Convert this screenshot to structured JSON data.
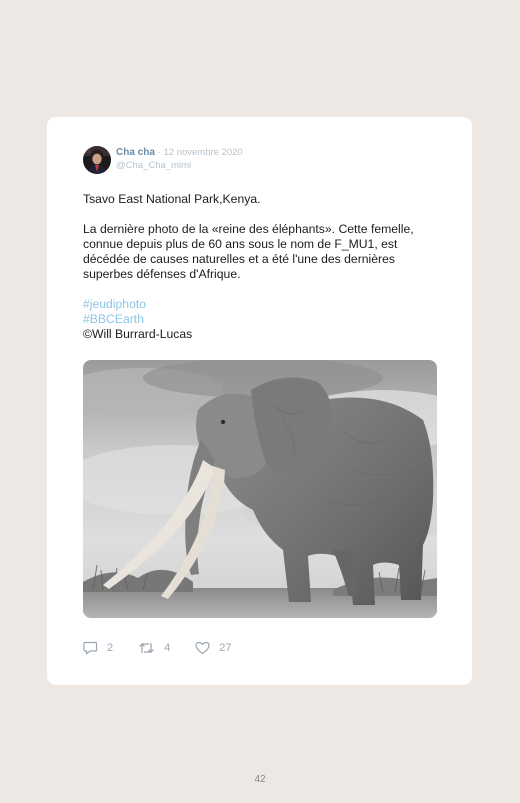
{
  "tweet": {
    "author_name": "Cha cha",
    "date": "· 12 novembre 2020",
    "handle": "@Cha_Cha_mimi",
    "location_line": "Tsavo East National Park,Kenya.",
    "body_text": "La dernière photo de la «reine des éléphants». Cette femelle, connue depuis plus de 60 ans sous le nom de F_MU1, est décédée de causes naturelles et a été l'une des dernières superbes défenses d'Afrique.",
    "hashtags": [
      "#jeudiphoto",
      "#BBCEarth"
    ],
    "credit": "Will Burrard-Lucas",
    "credit_symbol": "©",
    "photo_subject": "elephant-photo"
  },
  "actions": {
    "replies": "2",
    "retweets": "4",
    "likes": "27"
  },
  "page": {
    "number": "42"
  },
  "colors": {
    "background": "#ede8e4",
    "card": "#ffffff",
    "author_name": "#6b8ca6",
    "meta": "#b7c2cc",
    "hashtag": "#8cc6e6",
    "icon": "#9aa6b1"
  },
  "icons": {
    "reply": "reply-icon",
    "retweet": "retweet-icon",
    "like": "heart-icon",
    "copyright": "copyright-icon"
  }
}
